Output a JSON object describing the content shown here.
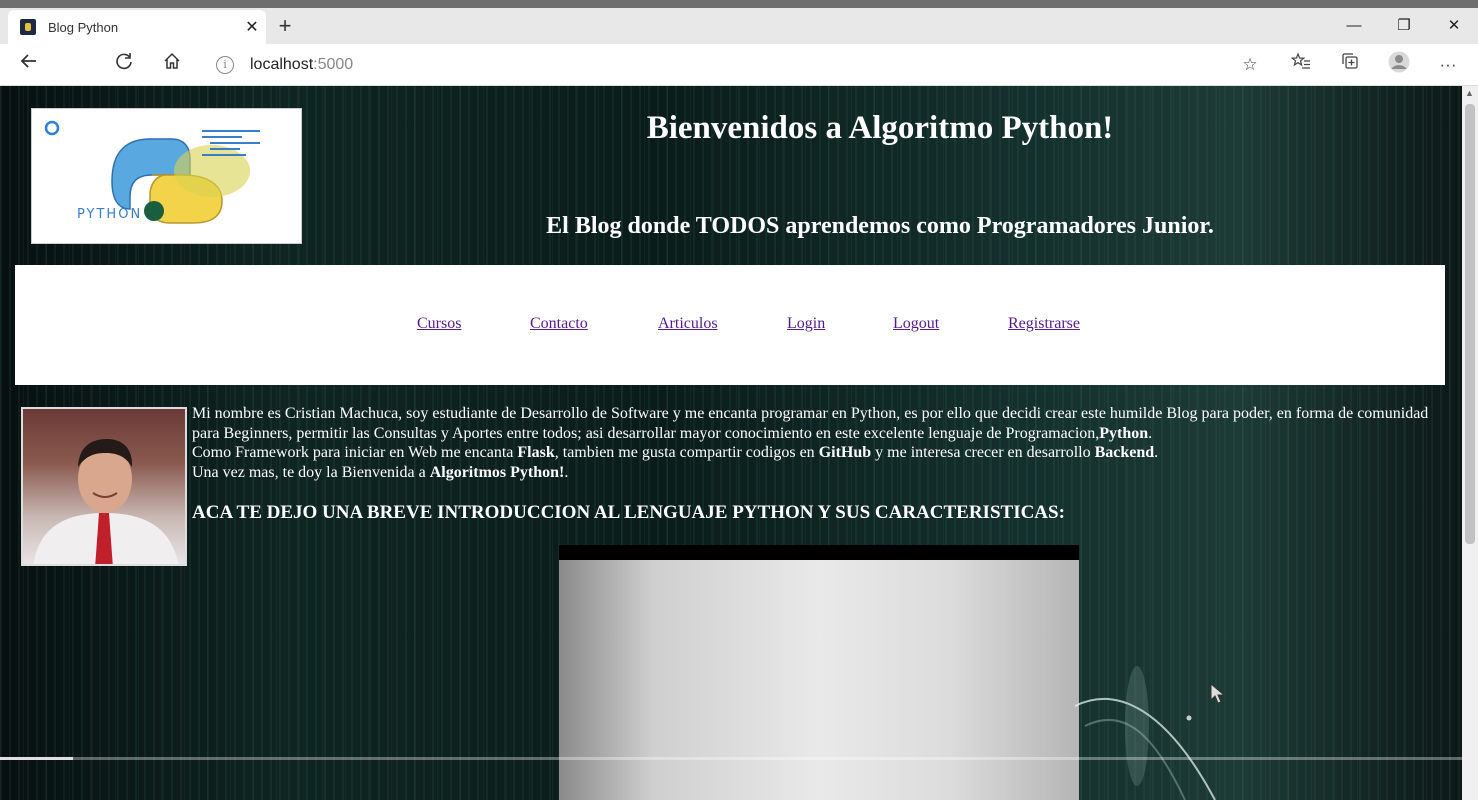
{
  "browser": {
    "tab_title": "Blog Python",
    "tab_close": "✕",
    "new_tab": "+",
    "url_host": "localhost",
    "url_port": ":5000",
    "window": {
      "minimize": "—",
      "restore": "❐",
      "close": "✕"
    },
    "icons": [
      "back-icon",
      "reload-icon",
      "home-icon",
      "info-icon",
      "favorite-star-icon",
      "favorites-list-icon",
      "collections-icon",
      "profile-icon",
      "more-icon"
    ]
  },
  "page": {
    "logo_text": "PYTHON",
    "heading": "Bienvenidos a Algoritmo Python!",
    "subheading": "El Blog donde TODOS aprendemos como Programadores Junior.",
    "nav": [
      "Cursos",
      "Contacto",
      "Articulos",
      "Login",
      "Logout",
      "Registrarse"
    ],
    "intro": {
      "line1_a": "Mi nombre es Cristian Machuca, soy estudiante de Desarrollo de Software y me encanta programar en Python, es por ello que decidi crear este humilde Blog para poder, en forma de comunidad para Beginners, permitir las Consultas y Aportes entre todos; asi desarrollar mayor conocimiento en este excelente lenguaje de Programacion,",
      "line1_b": "Python",
      "line1_c": ".",
      "line2_a": "Como Framework para iniciar en Web me encanta ",
      "line2_b": "Flask",
      "line2_c": ", tambien me gusta compartir codigos en ",
      "line2_d": "GitHub",
      "line2_e": " y me interesa crecer en desarrollo ",
      "line2_f": "Backend",
      "line2_g": ".",
      "line3_a": "Una vez mas, te doy la Bienvenida a ",
      "line3_b": "Algoritmos Python!",
      "line3_c": "."
    },
    "section_title": "ACA TE DEJO UNA BREVE INTRODUCCION AL LENGUAJE PYTHON Y SUS CARACTERISTICAS:",
    "video_progress": 0.05
  },
  "colors": {
    "link": "#551a8b",
    "accent": "#3a7dc9"
  }
}
